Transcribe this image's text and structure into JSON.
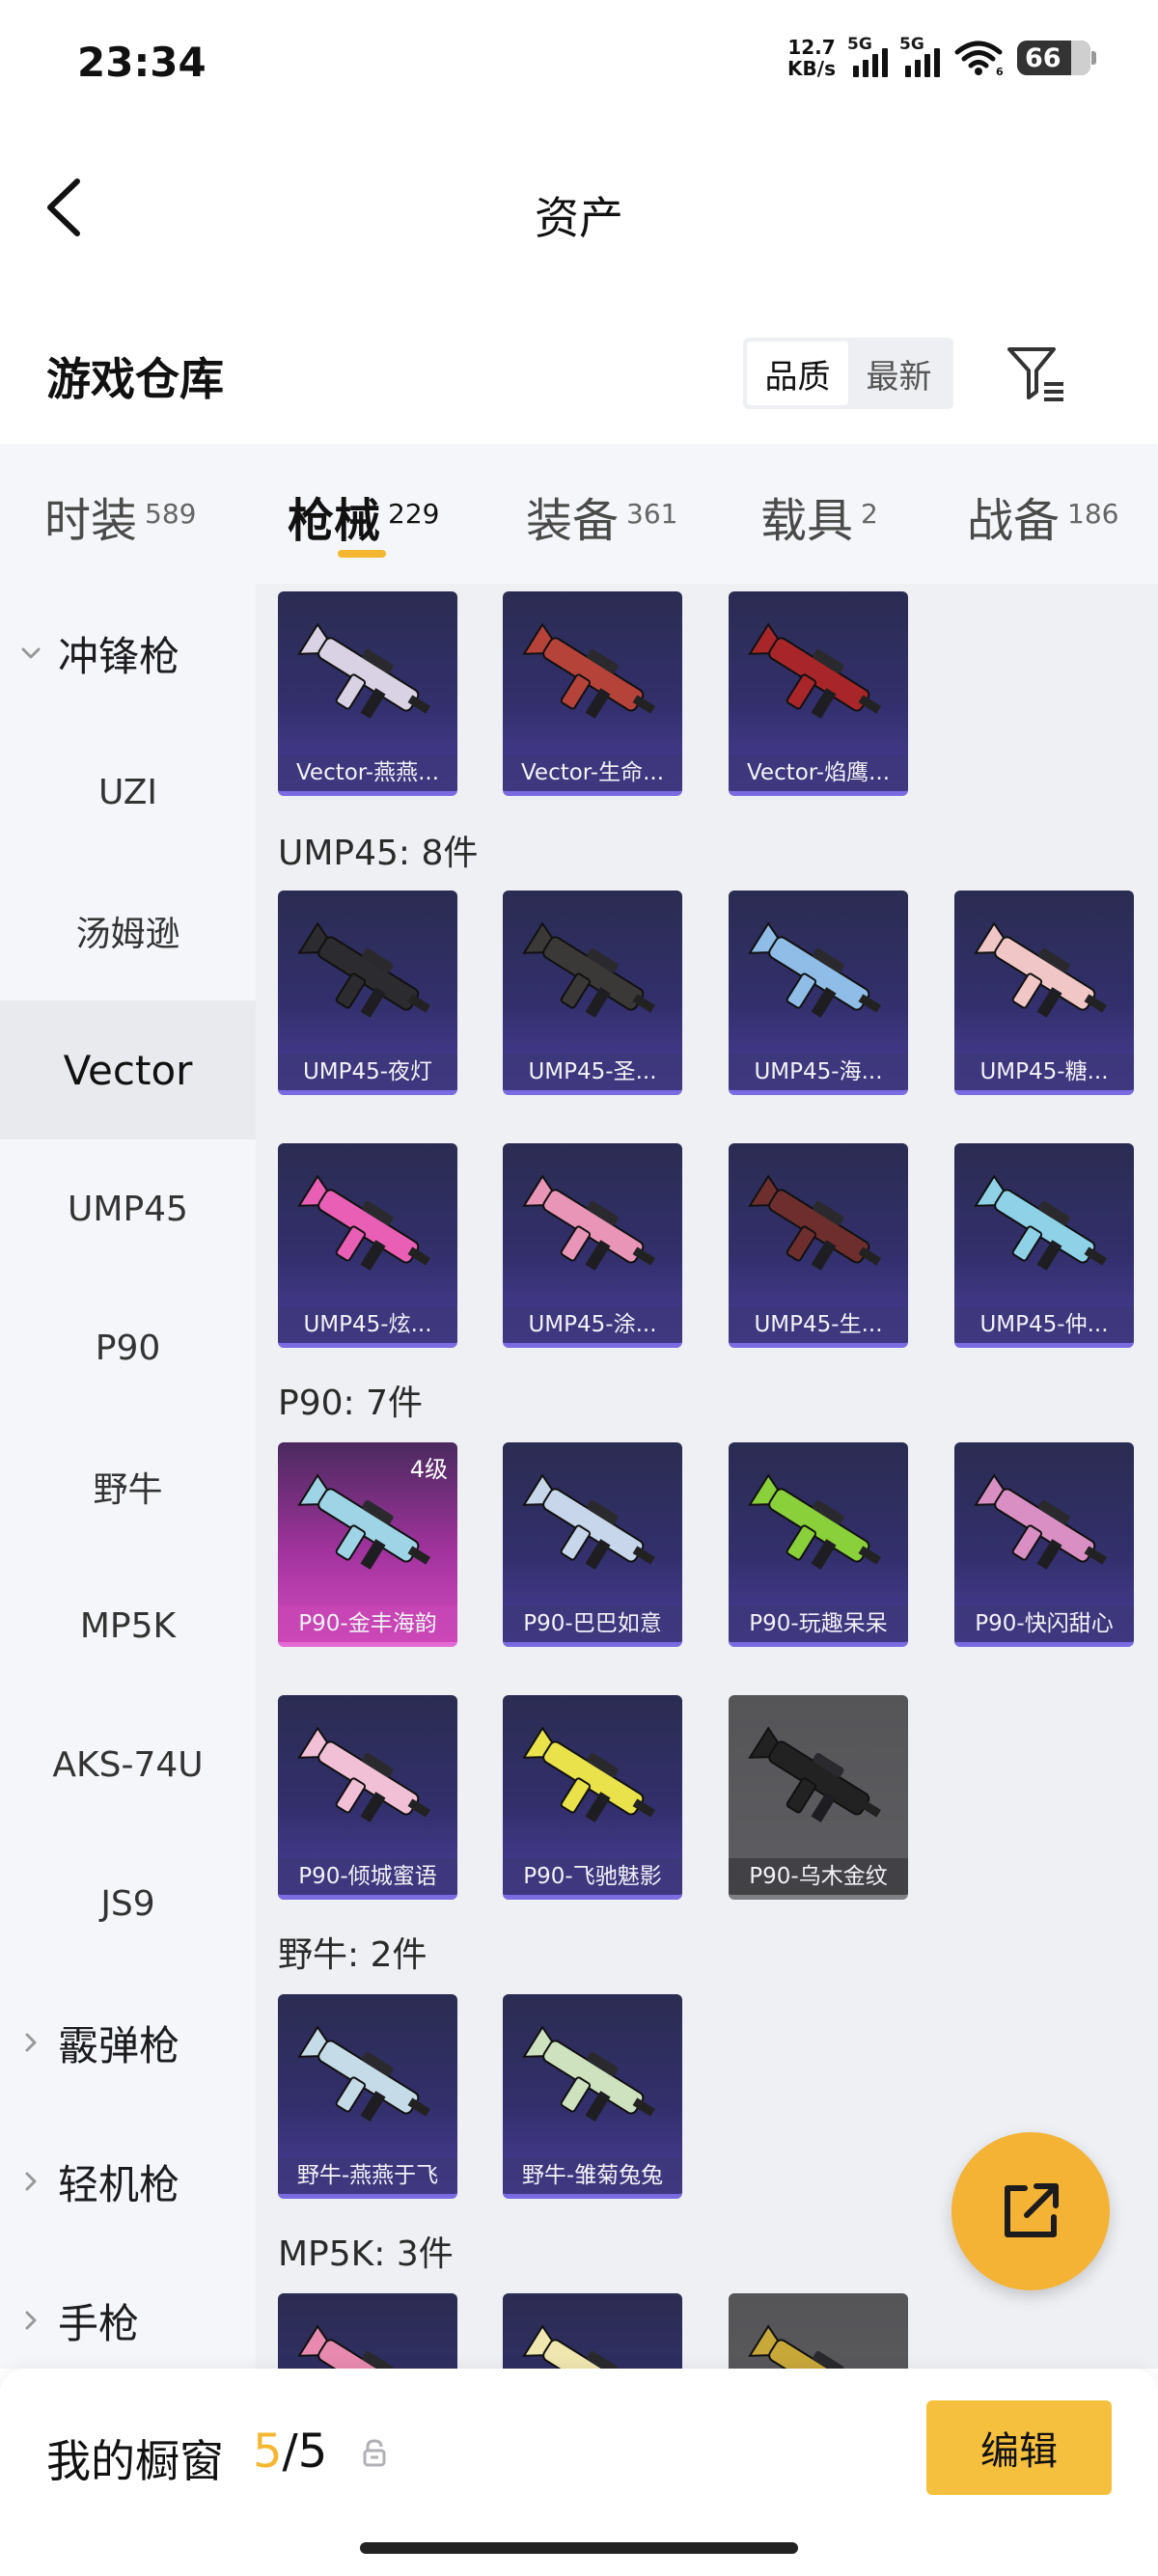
{
  "status_bar": {
    "time": "23:34",
    "net_speed_value": "12.7",
    "net_speed_unit": "KB/s",
    "sim1_label": "5G",
    "sim2_label": "5G",
    "wifi_sub": "6",
    "battery_level": "66"
  },
  "header": {
    "title": "资产",
    "back_icon": "chevron-left-icon"
  },
  "warehouse": {
    "title": "游戏仓库",
    "sort_options": [
      "品质",
      "最新"
    ],
    "selected_sort": "品质",
    "filter_icon": "filter-list-icon"
  },
  "tabs": [
    {
      "label": "时装",
      "count": "589"
    },
    {
      "label": "枪械",
      "count": "229"
    },
    {
      "label": "装备",
      "count": "361"
    },
    {
      "label": "载具",
      "count": "2"
    },
    {
      "label": "战备",
      "count": "186"
    }
  ],
  "active_tab": "枪械",
  "sidebar": {
    "items": [
      {
        "label": "冲锋枪",
        "type": "group",
        "expanded": true
      },
      {
        "label": "UZI",
        "type": "item"
      },
      {
        "label": "汤姆逊",
        "type": "item"
      },
      {
        "label": "Vector",
        "type": "item",
        "active": true
      },
      {
        "label": "UMP45",
        "type": "item"
      },
      {
        "label": "P90",
        "type": "item"
      },
      {
        "label": "野牛",
        "type": "item"
      },
      {
        "label": "MP5K",
        "type": "item"
      },
      {
        "label": "AKS-74U",
        "type": "item"
      },
      {
        "label": "JS9",
        "type": "item"
      },
      {
        "label": "霰弹枪",
        "type": "group",
        "expanded": false
      },
      {
        "label": "轻机枪",
        "type": "group",
        "expanded": false
      },
      {
        "label": "手枪",
        "type": "group",
        "expanded": false
      }
    ]
  },
  "sections": [
    {
      "title": "",
      "items": [
        {
          "name": "Vector-燕燕...",
          "rarity": "purple",
          "gun_color": "#d9d2e4"
        },
        {
          "name": "Vector-生命...",
          "rarity": "purple",
          "gun_color": "#b5433a"
        },
        {
          "name": "Vector-焰鹰...",
          "rarity": "purple",
          "gun_color": "#a8262a"
        }
      ]
    },
    {
      "title": "UMP45: 8件",
      "items": [
        {
          "name": "UMP45-夜灯",
          "rarity": "purple",
          "gun_color": "#2c2c30"
        },
        {
          "name": "UMP45-圣...",
          "rarity": "purple",
          "gun_color": "#3b3838"
        },
        {
          "name": "UMP45-海...",
          "rarity": "purple",
          "gun_color": "#8fbde8"
        },
        {
          "name": "UMP45-糖...",
          "rarity": "purple",
          "gun_color": "#f0c6c6"
        },
        {
          "name": "UMP45-炫...",
          "rarity": "purple",
          "gun_color": "#e85fb5"
        },
        {
          "name": "UMP45-涂...",
          "rarity": "purple",
          "gun_color": "#e895b8"
        },
        {
          "name": "UMP45-生...",
          "rarity": "purple",
          "gun_color": "#6e2e2e"
        },
        {
          "name": "UMP45-仲...",
          "rarity": "purple",
          "gun_color": "#8fd2e8"
        }
      ]
    },
    {
      "title": "P90: 7件",
      "items": [
        {
          "name": "P90-金丰海韵",
          "rarity": "pink",
          "level": "4级",
          "gun_color": "#9fd4e6"
        },
        {
          "name": "P90-巴巴如意",
          "rarity": "purple",
          "gun_color": "#c7d6ea"
        },
        {
          "name": "P90-玩趣呆呆",
          "rarity": "purple",
          "gun_color": "#8ad03a"
        },
        {
          "name": "P90-快闪甜心",
          "rarity": "purple",
          "gun_color": "#d98fc4"
        },
        {
          "name": "P90-倾城蜜语",
          "rarity": "purple",
          "gun_color": "#f2c0d6"
        },
        {
          "name": "P90-飞驰魅影",
          "rarity": "purple",
          "gun_color": "#e9e24a"
        },
        {
          "name": "P90-乌木金纹",
          "rarity": "gray",
          "gun_color": "#222222"
        }
      ]
    },
    {
      "title": "野牛: 2件",
      "items": [
        {
          "name": "野牛-燕燕于飞",
          "rarity": "purple",
          "gun_color": "#c6dbe8"
        },
        {
          "name": "野牛-雏菊兔兔",
          "rarity": "purple",
          "gun_color": "#cfe2c0"
        }
      ]
    },
    {
      "title": "MP5K: 3件",
      "items": [
        {
          "name": "",
          "rarity": "purple",
          "gun_color": "#e88ab0"
        },
        {
          "name": "",
          "rarity": "purple",
          "gun_color": "#f0e6b0"
        },
        {
          "name": "",
          "rarity": "gray",
          "gun_color": "#c9a83a"
        }
      ]
    }
  ],
  "float_button": {
    "icon": "external-link-icon"
  },
  "bottom": {
    "showcase_label": "我的橱窗",
    "count_current": "5",
    "count_separator": "/",
    "count_total": "5",
    "lock_icon": "lock-icon",
    "edit_label": "编辑"
  },
  "colors": {
    "accent": "#f5b731",
    "card_purple": "#322f6b",
    "card_pink": "#a2339e",
    "card_gray": "#5e5e62"
  }
}
